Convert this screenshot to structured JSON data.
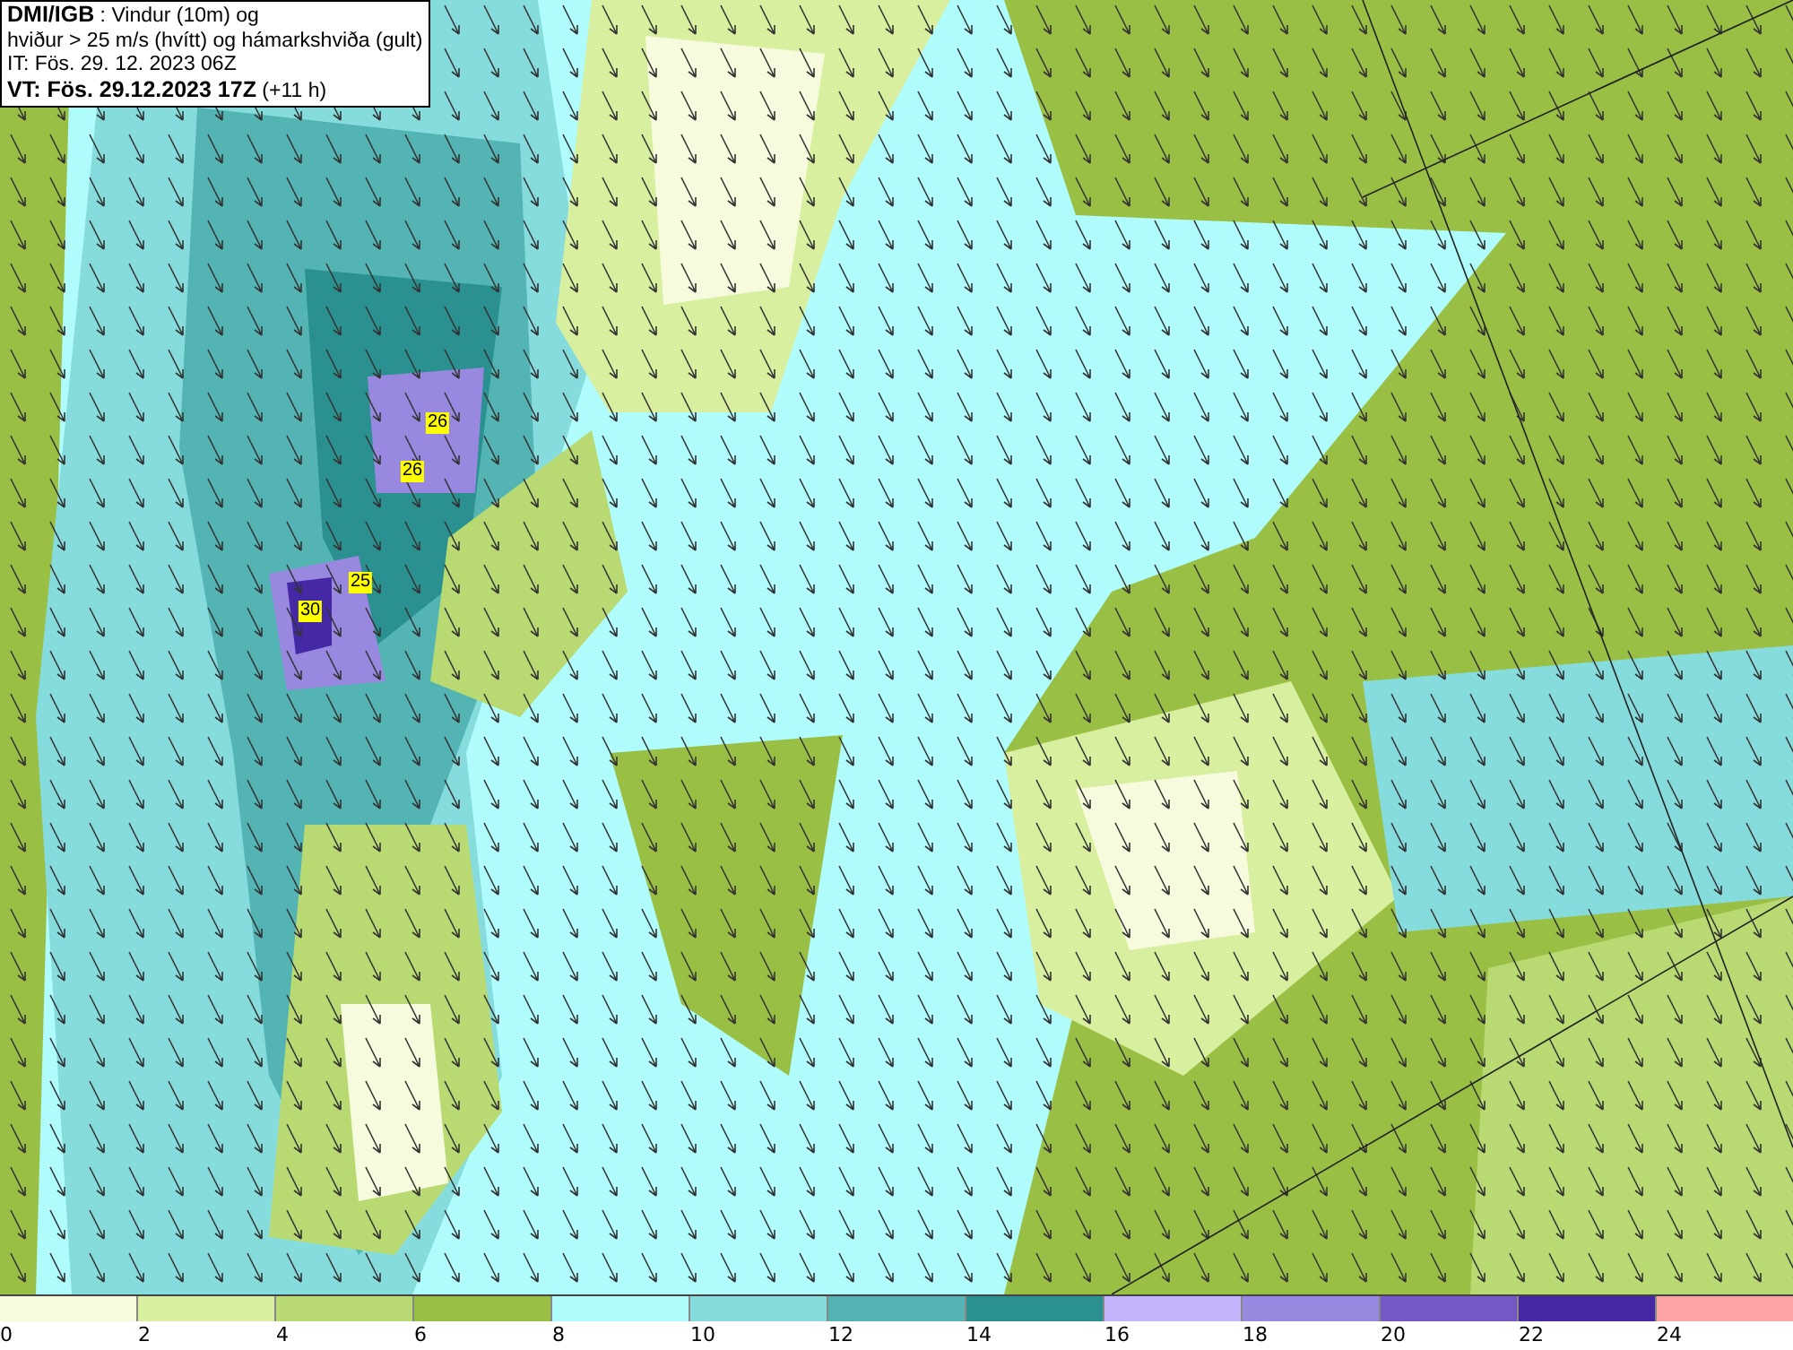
{
  "title_box": {
    "source": "DMI/IGB",
    "title_rest": " : Vindur (10m) og",
    "line_2": "hviður > 25 m/s (hvítt) og hámarkshviða (gult)",
    "issue_time": "IT: Fös. 29. 12. 2023 06Z",
    "valid_time": "VT: Fös. 29.12.2023 17Z",
    "lead": " (+11 h)"
  },
  "gust_labels": [
    {
      "text": "26"
    },
    {
      "text": "26"
    },
    {
      "text": "25"
    },
    {
      "text": "30"
    }
  ],
  "legend": {
    "bins": [
      {
        "color": "#f5fbdc"
      },
      {
        "color": "#d8ef9f"
      },
      {
        "color": "#b9da72"
      },
      {
        "color": "#9abf45"
      },
      {
        "color": "#b0fcfc"
      },
      {
        "color": "#86dcdc"
      },
      {
        "color": "#54b4b4"
      },
      {
        "color": "#2a9090"
      },
      {
        "color": "#c4b4fc"
      },
      {
        "color": "#9888e0"
      },
      {
        "color": "#7458c4"
      },
      {
        "color": "#4428a4"
      },
      {
        "color": "#fca4a4"
      }
    ],
    "ticks": [
      "0",
      "2",
      "4",
      "6",
      "8",
      "10",
      "12",
      "14",
      "16",
      "18",
      "20",
      "22",
      "24"
    ]
  }
}
